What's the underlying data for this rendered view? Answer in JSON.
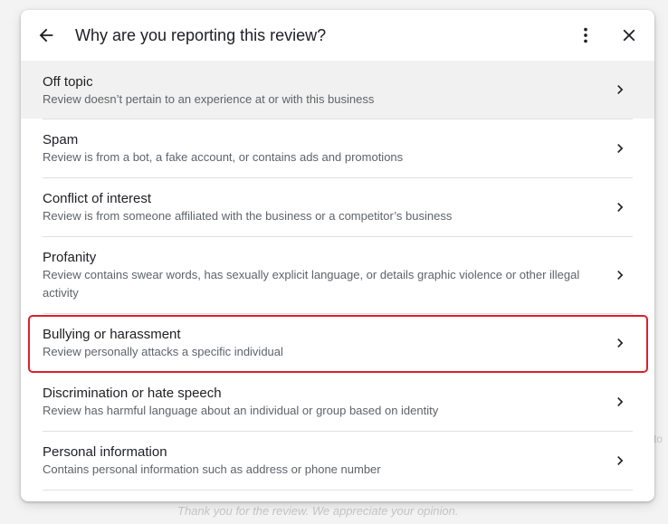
{
  "dialog": {
    "title": "Why are you reporting this review?",
    "icons": {
      "back": "arrow-back-icon",
      "more": "more-vert-icon",
      "close": "close-icon",
      "chevron": "chevron-right-icon"
    },
    "options": [
      {
        "title": "Off topic",
        "description": "Review doesn’t pertain to an experience at or with this business"
      },
      {
        "title": "Spam",
        "description": "Review is from a bot, a fake account, or contains ads and promotions"
      },
      {
        "title": "Conflict of interest",
        "description": "Review is from someone affiliated with the business or a competitor’s business"
      },
      {
        "title": "Profanity",
        "description": "Review contains swear words, has sexually explicit language, or details graphic violence or other illegal activity"
      },
      {
        "title": "Bullying or harassment",
        "description": "Review personally attacks a specific individual"
      },
      {
        "title": "Discrimination or hate speech",
        "description": "Review has harmful language about an individual or group based on identity"
      },
      {
        "title": "Personal information",
        "description": "Contains personal information such as address or phone number"
      }
    ],
    "hovered_option": "Off topic",
    "highlighted_option": "Bullying or harassment"
  },
  "background": {
    "footer_text": "Thank you for the review. We appreciate your opinion.",
    "right_hint": "to"
  },
  "colors": {
    "highlight": "#d9212c",
    "hover": "#f1f1f1",
    "title_text": "#202124",
    "secondary_text": "#5f6368"
  }
}
